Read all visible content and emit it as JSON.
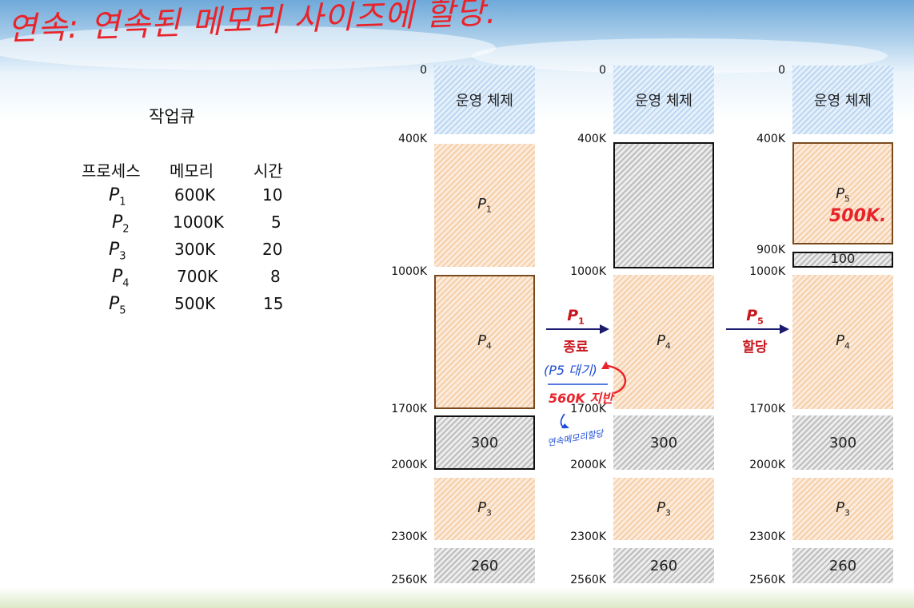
{
  "handwritten_title": "연속: 연속된 메모리 사이즈에 할당.",
  "job_queue": {
    "title": "작업큐",
    "headers": [
      "프로세스",
      "메모리",
      "시간"
    ],
    "rows": [
      {
        "p": "P",
        "sub": "1",
        "mem": "600K",
        "time": "10"
      },
      {
        "p": "P",
        "sub": "2",
        "mem": "1000K",
        "time": "5"
      },
      {
        "p": "P",
        "sub": "3",
        "mem": "300K",
        "time": "20"
      },
      {
        "p": "P",
        "sub": "4",
        "mem": "700K",
        "time": "8"
      },
      {
        "p": "P",
        "sub": "5",
        "mem": "500K",
        "time": "15"
      }
    ]
  },
  "os_label": "운영 체제",
  "p_letter": "P",
  "col1": {
    "addrs": [
      "0",
      "400K",
      "1000K",
      "1700K",
      "2000K",
      "2300K",
      "2560K"
    ],
    "p1_sub": "1",
    "p4_sub": "4",
    "p3_sub": "3",
    "hole300": "300",
    "hole260": "260"
  },
  "col2": {
    "addrs": [
      "0",
      "400K",
      "1000K",
      "1700K",
      "2000K",
      "2300K",
      "2560K"
    ],
    "p4_sub": "4",
    "p3_sub": "3",
    "hole300": "300",
    "hole260": "260"
  },
  "col3": {
    "addrs": [
      "0",
      "400K",
      "900K",
      "1000K",
      "1700K",
      "2000K",
      "2300K",
      "2560K"
    ],
    "p5_sub": "5",
    "p4_sub": "4",
    "p3_sub": "3",
    "hole100": "100",
    "hole300": "300",
    "hole260": "260",
    "p5_note": "500K."
  },
  "arrow1": {
    "p_sub": "1",
    "label": "종료"
  },
  "arrow2": {
    "p_sub": "5",
    "label": "할당"
  },
  "notes": {
    "wait": "(P5 대기)",
    "short": "560K 지반",
    "contig": "연속메모리할당"
  },
  "colors": {
    "handwriting_red": "#e8242a",
    "handwriting_blue": "#1f4fd6",
    "arrow_navy": "#1a1a6e",
    "label_red": "#c8161d"
  }
}
